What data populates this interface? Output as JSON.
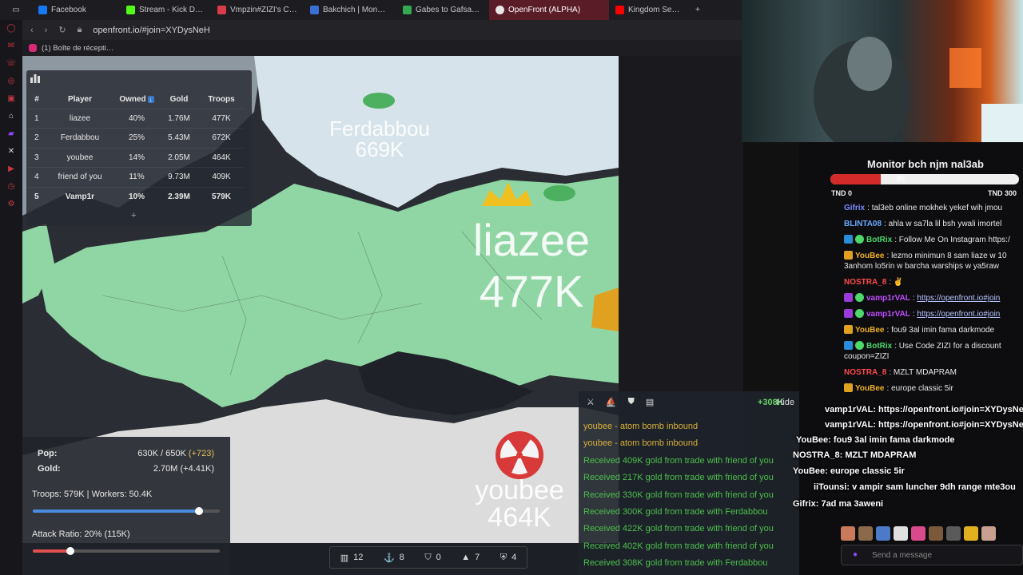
{
  "browser": {
    "tabs": [
      {
        "label": "Facebook",
        "color": "#1877f2"
      },
      {
        "label": "Stream - Kick D…",
        "color": "#53fc18"
      },
      {
        "label": "Vmpzin#ZIZI's C…",
        "color": "#d83c4a"
      },
      {
        "label": "Bakchich | Mon…",
        "color": "#3a6fd8"
      },
      {
        "label": "Gabes to Gafsa…",
        "color": "#34a853"
      },
      {
        "label": "OpenFront (ALPHA)",
        "color": "#e8e8e8",
        "active": true
      },
      {
        "label": "Kingdom Se…",
        "color": "#ff0000"
      }
    ],
    "url": "openfront.io/#join=XYDysNeH",
    "bookmark": "(1) Boîte de récepti…"
  },
  "leaderboard": {
    "headers": [
      "#",
      "Player",
      "Owned",
      "Gold",
      "Troops"
    ],
    "rows": [
      {
        "rank": "1",
        "player": "liazee",
        "owned": "40%",
        "gold": "1.76M",
        "troops": "477K"
      },
      {
        "rank": "2",
        "player": "Ferdabbou",
        "owned": "25%",
        "gold": "5.43M",
        "troops": "672K"
      },
      {
        "rank": "3",
        "player": "youbee",
        "owned": "14%",
        "gold": "2.05M",
        "troops": "464K"
      },
      {
        "rank": "4",
        "player": "friend of you",
        "owned": "11%",
        "gold": "9.73M",
        "troops": "409K"
      },
      {
        "rank": "5",
        "player": "Vamp1r",
        "owned": "10%",
        "gold": "2.39M",
        "troops": "579K",
        "me": true
      }
    ],
    "sort_arrow": "↓",
    "expand": "+"
  },
  "map_labels": {
    "ferdabbou_name": "Ferdabbou",
    "ferdabbou_troops": "669K",
    "liazee_name": "liazee",
    "liazee_troops": "477K",
    "youbee_name": "youbee",
    "youbee_troops": "464K"
  },
  "stats": {
    "pop_label": "Pop:",
    "pop_value": "630K / 650K",
    "pop_delta": "(+723)",
    "gold_label": "Gold:",
    "gold_value": "2.70M (+4.41K)",
    "troops_workers": "Troops: 579K | Workers: 50.4K",
    "troops_ratio": 0.89,
    "attack_ratio_label": "Attack Ratio: 20% (115K)",
    "attack_ratio": 0.2
  },
  "controls": [
    {
      "icon": "city-icon",
      "value": "12"
    },
    {
      "icon": "port-icon",
      "value": "8"
    },
    {
      "icon": "defense-icon",
      "value": "0"
    },
    {
      "icon": "missile-icon",
      "value": "7"
    },
    {
      "icon": "sam-icon",
      "value": "4"
    }
  ],
  "events": {
    "score": "+308K",
    "hide_label": "Hide",
    "lines": [
      {
        "text": "youbee - atom bomb inbound",
        "kind": "yellow"
      },
      {
        "text": "youbee - atom bomb inbound",
        "kind": "yellow"
      },
      {
        "text": "Received 409K gold from trade with friend of you",
        "kind": "green"
      },
      {
        "text": "Received 217K gold from trade with friend of you",
        "kind": "green"
      },
      {
        "text": "Received 330K gold from trade with friend of you",
        "kind": "green"
      },
      {
        "text": "Received 300K gold from trade with Ferdabbou",
        "kind": "green"
      },
      {
        "text": "Received 422K gold from trade with friend of you",
        "kind": "green"
      },
      {
        "text": "Received 402K gold from trade with friend of you",
        "kind": "green"
      },
      {
        "text": "Received 308K gold from trade with Ferdabbou",
        "kind": "green"
      }
    ]
  },
  "monitor": {
    "title": "Monitor bch njm nal3ab",
    "progress_value": "80",
    "progress": 0.267,
    "min_label": "TND 0",
    "max_label": "TND 300"
  },
  "chat": [
    {
      "user": "Gifrix",
      "color": "#7b8bff",
      "text": "tal3eb online mokhek yekef wih jmou"
    },
    {
      "user": "BLINTA08",
      "color": "#6aa8ff",
      "text": "ahla w sa7la lil bsh ywali imortel"
    },
    {
      "user": "BotRix",
      "color": "#4dd86a",
      "badge": "#2a8bd8",
      "text": "Follow Me On Instagram https:/"
    },
    {
      "user": "YouBee",
      "color": "#f0b020",
      "badge": "#e0a020",
      "text": "lezmo minimun 8 sam liaze w 10"
    },
    {
      "user": "",
      "color": "#e6e6e6",
      "text": "3anhom lo5rin w barcha warships w ya5raw"
    },
    {
      "user": "NOSTRA_8",
      "color": "#ff4a4a",
      "text": "✌"
    },
    {
      "user": "vamp1rVAL",
      "color": "#c04cff",
      "badge": "#9a3ad8",
      "text": "https://openfront.io#join",
      "link": true
    },
    {
      "user": "vamp1rVAL",
      "color": "#c04cff",
      "badge": "#9a3ad8",
      "text": "https://openfront.io#join",
      "link": true
    },
    {
      "user": "YouBee",
      "color": "#f0b020",
      "badge": "#e0a020",
      "text": "fou9 3al imin fama darkmode"
    },
    {
      "user": "BotRix",
      "color": "#4dd86a",
      "badge": "#2a8bd8",
      "text": "Use Code ZIZI for a discount"
    },
    {
      "user": "",
      "color": "#e6e6e6",
      "text": "coupon=ZIZI"
    },
    {
      "user": "NOSTRA_8",
      "color": "#ff4a4a",
      "text": "MZLT MDAPRAM"
    },
    {
      "user": "YouBee",
      "color": "#f0b020",
      "badge": "#e0a020",
      "text": "europe classic 5ir"
    }
  ],
  "overlay_chat": [
    {
      "text": "vamp1rVAL: https://openfront.io#join=XYDysNe",
      "color": "#c04cff"
    },
    {
      "text": "vamp1rVAL: https://openfront.io#join=XYDysNe",
      "color": "#c04cff"
    },
    {
      "text": "YouBee: fou9 3al imin fama darkmode",
      "color": "#f0b020"
    },
    {
      "text": "NOSTRA_8: MZLT MDAPRAM",
      "color": "#ff4a4a"
    },
    {
      "text": "YouBee: europe classic 5ir",
      "color": "#f0b020"
    },
    {
      "text": "iiTounsi: v ampir sam luncher 9dh range mte3ou",
      "color": "#6ad36a"
    },
    {
      "text": "Gifrix: 7ad ma 3aweni",
      "color": "#7b8bff"
    }
  ],
  "chat_input_placeholder": "Send a message"
}
